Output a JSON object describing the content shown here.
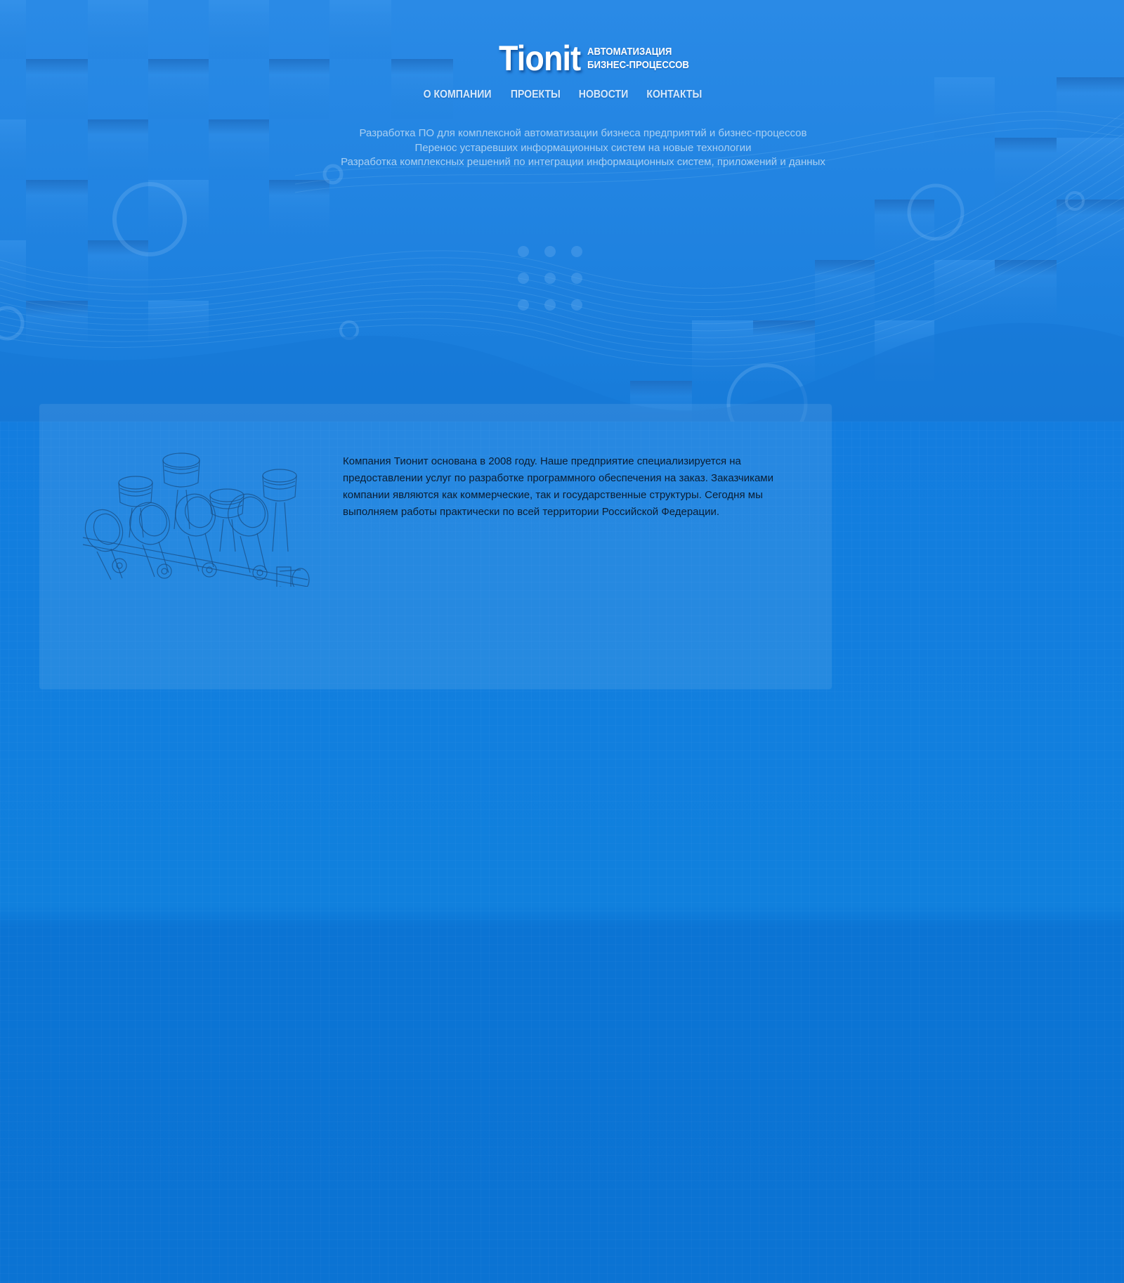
{
  "header": {
    "logo": "Tionit",
    "tagline_line1": "АВТОМАТИЗАЦИЯ",
    "tagline_line2": "БИЗНЕС-ПРОЦЕССОВ"
  },
  "nav": {
    "items": [
      {
        "label": "О КОМПАНИИ"
      },
      {
        "label": "ПРОЕКТЫ"
      },
      {
        "label": "НОВОСТИ"
      },
      {
        "label": "КОНТАКТЫ"
      }
    ]
  },
  "hero": {
    "lines": [
      "Разработка ПО для комплексной автоматизации бизнеса предприятий и бизнес-процессов",
      "Перенос устаревших информационных систем на новые технологии",
      "Разработка комплексных решений по интеграции информационных систем, приложений и данных"
    ]
  },
  "about": {
    "text": "Компания Тионит основана в 2008 году. Наше предприятие специализируется на предоставлении услуг по разработке программного обеспечения на заказ. Заказчиками компании являются как коммерческие, так и государственные структуры. Сегодня мы выполняем работы практически по всей территории Российской Федерации.",
    "image_icon": "engine-blueprint-icon"
  },
  "colors": {
    "background": "#0d76d6",
    "hero_light": "#2e8de8",
    "nav_text": "#d6e9fb",
    "hero_text": "#a9cff1",
    "body_text": "#0a1d33"
  }
}
